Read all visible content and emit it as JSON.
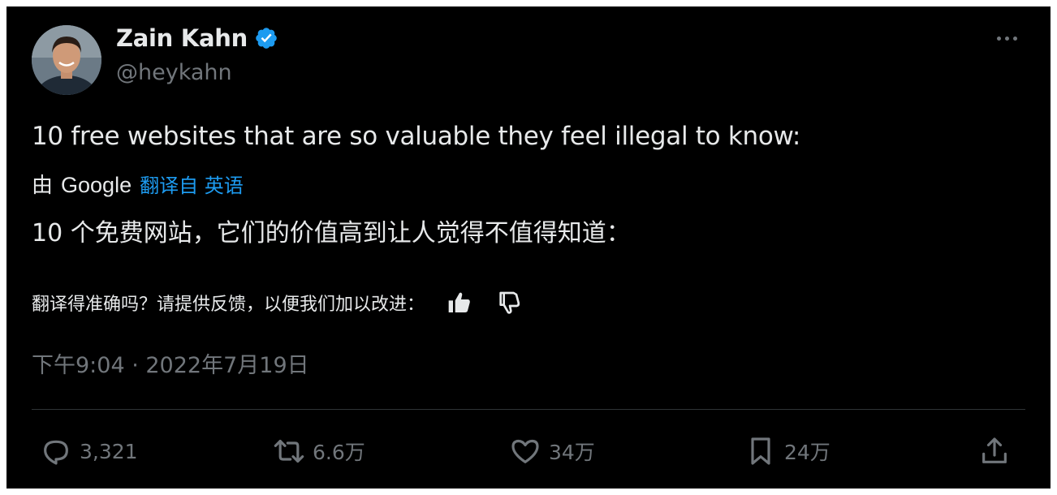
{
  "author": {
    "name": "Zain Kahn",
    "handle": "@heykahn",
    "verified_color": "#1d9bf0"
  },
  "tweet": {
    "text": "10 free websites that are so valuable they feel illegal to know:",
    "translated_by_prefix": "由",
    "translated_by_brand": "Google",
    "translated_from": "翻译自 英语",
    "translation": "10 个免费网站，它们的价值高到让人觉得不值得知道：",
    "feedback_question": "翻译得准确吗？请提供反馈，以便我们加以改进：",
    "timestamp": "下午9:04 · 2022年7月19日"
  },
  "actions": {
    "replies": "3,321",
    "retweets": "6.6万",
    "likes": "34万",
    "bookmarks": "24万"
  },
  "colors": {
    "background": "#000000",
    "text": "#e7e9ea",
    "muted": "#71767b",
    "link": "#1d9bf0",
    "divider": "#2f3336"
  }
}
